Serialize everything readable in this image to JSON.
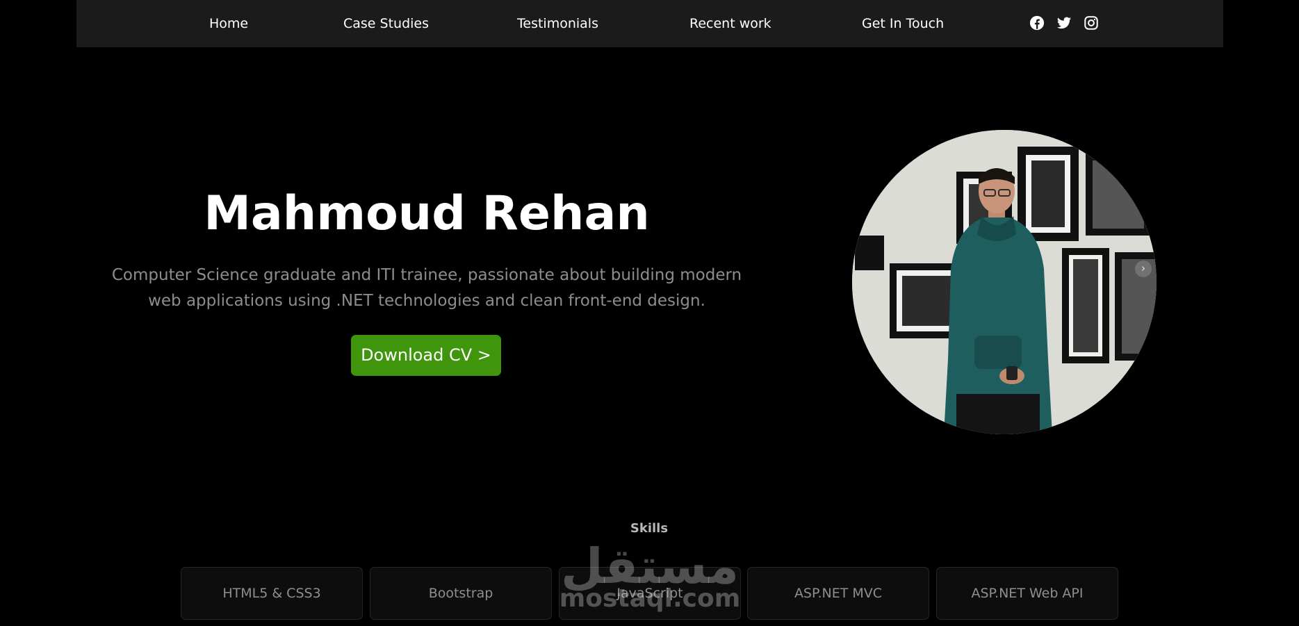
{
  "nav": {
    "links": [
      "Home",
      "Case Studies",
      "Testimonials",
      "Recent work",
      "Get In Touch"
    ],
    "social_icons": [
      "facebook-icon",
      "twitter-icon",
      "instagram-icon"
    ]
  },
  "hero": {
    "name": "Mahmoud Rehan",
    "description": "Computer Science graduate and ITI trainee, passionate about building modern web applications using .NET technologies and clean front-end design.",
    "cv_button": "Download CV >",
    "carousel_next_glyph": "›"
  },
  "skills": {
    "title": "Skills",
    "items": [
      "HTML5 & CSS3",
      "Bootstrap",
      "JavaScript",
      "ASP.NET MVC",
      "ASP.NET Web API"
    ]
  },
  "watermark": {
    "arabic": "مستقل",
    "latin": "mostaql.com"
  },
  "colors": {
    "background": "#000000",
    "navbar": "#1b1b1b",
    "accent_button": "#3f960c",
    "text_muted": "#8d8d8d"
  }
}
